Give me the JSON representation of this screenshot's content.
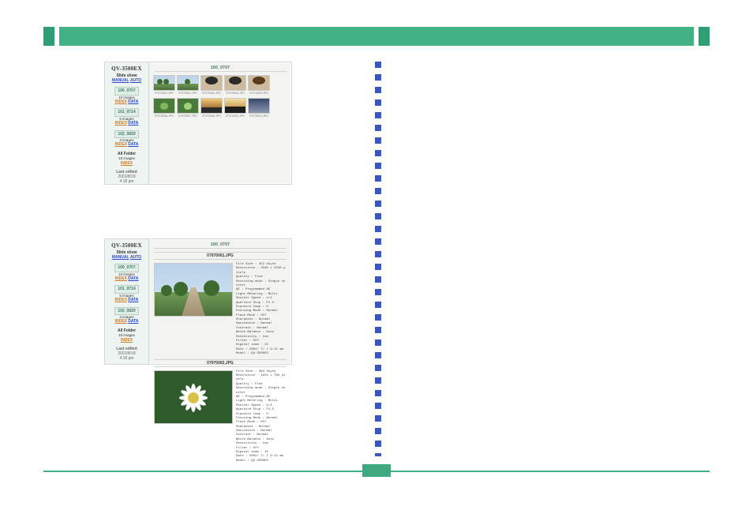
{
  "page": {
    "number": ""
  },
  "common": {
    "slideshow": "Slide show",
    "manual": "MANUAL",
    "auto": "AUTO",
    "index": "INDEX",
    "data": "DATA",
    "allfolder": "All Folder",
    "lastedited": "Last edited",
    "chip": "▣"
  },
  "s1": {
    "model": "QV-3500EX",
    "currentFolder": "100_0707",
    "folders": [
      {
        "name": "100_0707",
        "count": "10 images"
      },
      {
        "name": "101_0714",
        "count": "5 images"
      },
      {
        "name": "102_0820",
        "count": "3 images"
      }
    ],
    "totalcount": "18 images",
    "lastdate": "2001/8/18",
    "lasttime": "4:18 pm",
    "thumbs": [
      "07070001.JPG",
      "07070002.JPG",
      "07070003.JPG",
      "07070004.JPG",
      "07070005.JPG",
      "07070006.JPG",
      "07070007.JPG",
      "07070008.JPG",
      "07070009.JPG",
      "07070010.JPG"
    ]
  },
  "s2": {
    "model": "QV-3500EX",
    "currentFolder": "100_0707",
    "folders": [
      {
        "name": "100_0707",
        "count": "10 images"
      },
      {
        "name": "101_0714",
        "count": "5 images"
      },
      {
        "name": "102_0820",
        "count": "3 images"
      }
    ],
    "totalcount": "18 images",
    "lastdate": "2001/8/18",
    "lasttime": "4:18 pm",
    "items": [
      {
        "file": "07070001.JPG",
        "meta": "File Size       : 352 kbyte\nResolution      : 2048 x 1536 pixels\nQuality         : Fine\nRecording mode  : Single shutter\nAE              : Programmed AE\nLight Metering  : Multi\nShutter Speed   : 1/4\nAperture Stop   : F2.3\nExposure Comp   : 0\nFocusing Mode   : Normal\nFlash Mode      : Off\nSharpness       : Normal\nSaturation      : Normal\nContrast        : Normal\nWhite Balance   : Auto\nSensitivity     : Low\nFilter          : Off\nDigital zoom    : 1X\nDate            : 2001/ 7/ 7 9:12 am\nModel           : QV-3500EX"
      },
      {
        "file": "07070002.JPG",
        "meta": "File Size       : 384 kbyte\nResolution      : 1024 x 768 pixels\nQuality         : Fine\nRecording mode  : Single shutter\nAE              : Programmed AE\nLight Metering  : Multi\nShutter Speed   : 1/4\nAperture Stop   : F2.3\nExposure Comp   : 0\nFocusing Mode   : Normal\nFlash Mode      : Off\nSharpness       : Normal\nSaturation      : Normal\nContrast        : Normal\nWhite Balance   : Auto\nSensitivity     : Low\nFilter          : Off\nDigital zoom    : 1X\nDate            : 2001/ 7/ 7 9:12 am\nModel           : QV-3500EX"
      }
    ]
  }
}
